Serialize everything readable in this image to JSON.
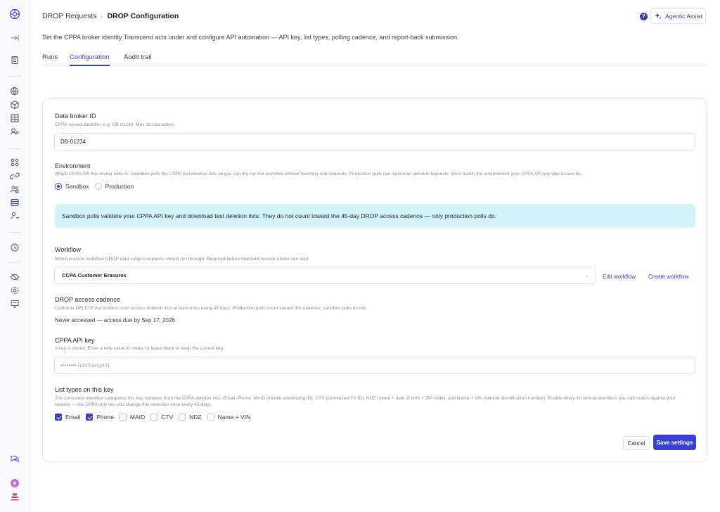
{
  "breadcrumb": {
    "parent": "DROP Requests",
    "separator": "›",
    "current": "DROP Configuration"
  },
  "header": {
    "help_glyph": "?",
    "assist_label": "Agentic Assist"
  },
  "page": {
    "description": "Set the CPPA broker identity Transcend acts under and configure API automation — API key, list types, polling cadence, and report-back submission."
  },
  "tabs": [
    {
      "label": "Runs",
      "active": false
    },
    {
      "label": "Configuration",
      "active": true
    },
    {
      "label": "Audit trail",
      "active": false
    }
  ],
  "broker_id": {
    "label": "Data broker ID",
    "help": "CPPA-issued identifier, e.g. DB-01234. Max 16 characters.",
    "value": "DB-01234"
  },
  "environment": {
    "label": "Environment",
    "help": "Which CPPA API this broker talks to. Sandbox pulls the CPPA test deletion lists so you can dry-run the workflow without touching real requests; Production pulls live consumer deletion requests. Must match the environment your CPPA API key was issued for.",
    "options": [
      {
        "label": "Sandbox",
        "selected": true
      },
      {
        "label": "Production",
        "selected": false
      }
    ],
    "banner": "Sandbox polls validate your CPPA API key and download test deletion lists. They do not count toward the 45-day DROP access cadence — only production polls do."
  },
  "workflow": {
    "label": "Workflow",
    "help": "Which erasure workflow DROP data subject requests should run through. Required before matched-records intake can start.",
    "selected": "CCPA Customer Erasures",
    "edit_label": "Edit workflow",
    "create_label": "Create workflow"
  },
  "cadence": {
    "label": "DROP access cadence",
    "help": "California DELETE Act brokers must access deletion lists at least once every 45 days. Production polls count toward this cadence; sandbox polls do not.",
    "status": "Never accessed — access due by Sep 17, 2026"
  },
  "api_key": {
    "label": "CPPA API key",
    "help": "A key is stored. Enter a new value to rotate, or leave blank to keep the current key.",
    "placeholder": "•••••••• (unchanged)"
  },
  "list_types": {
    "label": "List types on this key",
    "help": "The consumer-identifier categories this key retrieves from the CPPA deletion lists: Email, Phone, MAID (mobile advertising ID), CTV (connected-TV ID), NDZ (name + date of birth + ZIP code), and Name + VIN (vehicle identification number). Enable every list whose identifiers you can match against your records — the CPPA only lets you change this selection once every 45 days.",
    "items": [
      {
        "label": "Email",
        "checked": true
      },
      {
        "label": "Phone",
        "checked": true
      },
      {
        "label": "MAID",
        "checked": false
      },
      {
        "label": "CTV",
        "checked": false
      },
      {
        "label": "NDZ",
        "checked": false
      },
      {
        "label": "Name + VIN",
        "checked": false
      }
    ]
  },
  "actions": {
    "cancel": "Cancel",
    "save": "Save settings"
  },
  "colors": {
    "accent": "#3a3fd6",
    "banner_bg": "#d3f3f8",
    "logo_purple": "#5b4fd8",
    "avatar_pink": "#c86fd6",
    "bottom_icon": "#d4367a"
  },
  "rail_icons": [
    "app-logo-icon",
    "collapse-sidebar-icon",
    "clipboard-icon",
    "globe-lock-icon",
    "cube-icon",
    "data-table-icon",
    "people-search-icon",
    "apps-grid-icon",
    "link-icon",
    "user-group-icon",
    "database-icon",
    "user-key-icon",
    "privacy-shield-icon",
    "eye-off-icon",
    "settings-gear-icon",
    "monitor-icon",
    "chat-icon",
    "user-avatar-icon",
    "assistant-icon"
  ]
}
